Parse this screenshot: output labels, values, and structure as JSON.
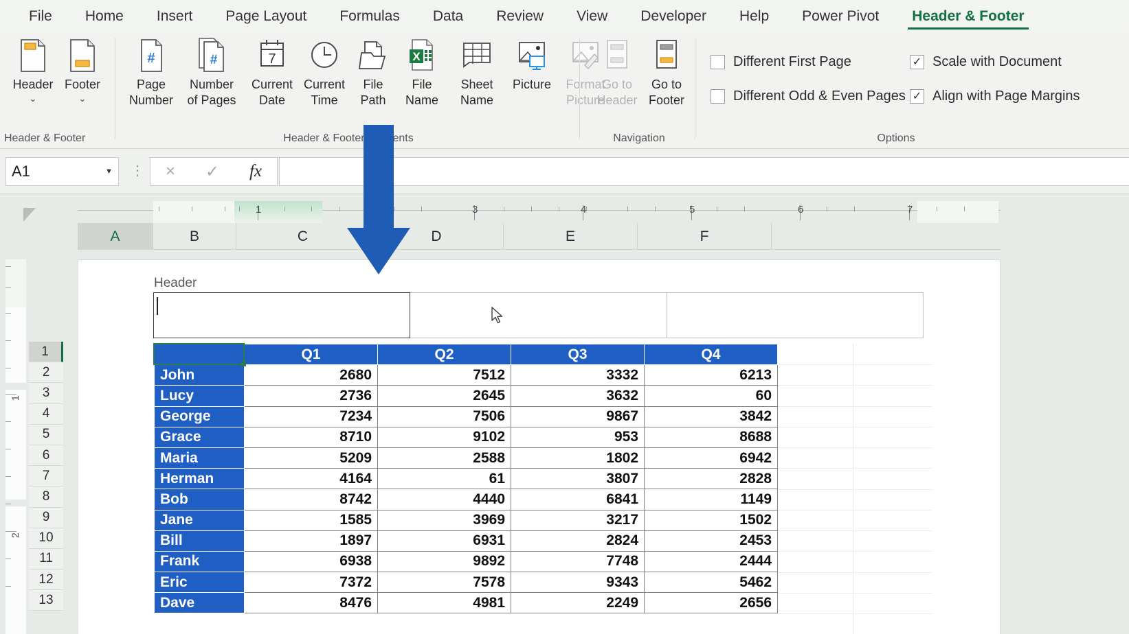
{
  "app": {
    "active_cell": "A1",
    "formula_value": ""
  },
  "ribbon_tabs": [
    {
      "label": "File",
      "active": false
    },
    {
      "label": "Home",
      "active": false
    },
    {
      "label": "Insert",
      "active": false
    },
    {
      "label": "Page Layout",
      "active": false
    },
    {
      "label": "Formulas",
      "active": false
    },
    {
      "label": "Data",
      "active": false
    },
    {
      "label": "Review",
      "active": false
    },
    {
      "label": "View",
      "active": false
    },
    {
      "label": "Developer",
      "active": false
    },
    {
      "label": "Help",
      "active": false
    },
    {
      "label": "Power Pivot",
      "active": false
    },
    {
      "label": "Header & Footer",
      "active": true
    }
  ],
  "ribbon_groups": {
    "header_footer": {
      "label": "Header & Footer",
      "buttons": [
        {
          "line1": "Header",
          "line2": "",
          "caret": "⌄",
          "icon": "header-document-icon",
          "disabled": false
        },
        {
          "line1": "Footer",
          "line2": "",
          "caret": "⌄",
          "icon": "footer-document-icon",
          "disabled": false
        }
      ]
    },
    "elements": {
      "label": "Header & Footer Elements",
      "buttons": [
        {
          "line1": "Page",
          "line2": "Number",
          "icon": "page-number-icon",
          "disabled": false
        },
        {
          "line1": "Number",
          "line2": "of Pages",
          "icon": "number-of-pages-icon",
          "disabled": false
        },
        {
          "line1": "Current",
          "line2": "Date",
          "icon": "calendar-icon",
          "disabled": false
        },
        {
          "line1": "Current",
          "line2": "Time",
          "icon": "clock-icon",
          "disabled": false
        },
        {
          "line1": "File",
          "line2": "Path",
          "icon": "folder-file-icon",
          "disabled": false
        },
        {
          "line1": "File",
          "line2": "Name",
          "icon": "excel-file-icon",
          "disabled": false
        },
        {
          "line1": "Sheet",
          "line2": "Name",
          "icon": "sheet-grid-icon",
          "disabled": false
        },
        {
          "line1": "Picture",
          "line2": "",
          "icon": "picture-icon",
          "disabled": false
        },
        {
          "line1": "Format",
          "line2": "Picture",
          "icon": "format-picture-icon",
          "disabled": true
        }
      ]
    },
    "navigation": {
      "label": "Navigation",
      "buttons": [
        {
          "line1": "Go to",
          "line2": "Header",
          "icon": "go-to-header-icon",
          "disabled": true
        },
        {
          "line1": "Go to",
          "line2": "Footer",
          "icon": "go-to-footer-icon",
          "disabled": false
        }
      ]
    },
    "options": {
      "label": "Options",
      "checkboxes": [
        {
          "label": "Different First Page",
          "checked": false
        },
        {
          "label": "Different Odd & Even Pages",
          "checked": false
        },
        {
          "label": "Scale with Document",
          "checked": true
        },
        {
          "label": "Align with Page Margins",
          "checked": true
        }
      ]
    }
  },
  "formula_bar": {
    "name_box_value": "A1",
    "cancel_icon": "×",
    "enter_icon": "✓",
    "fx_icon": "fx",
    "input_value": ""
  },
  "rulers": {
    "horizontal_numbers": [
      "1",
      "2",
      "3",
      "4",
      "5",
      "6",
      "7"
    ],
    "vertical_numbers": [
      "1",
      "2"
    ]
  },
  "grid": {
    "columns": [
      "A",
      "B",
      "C",
      "D",
      "E",
      "F"
    ],
    "selected_column": "A",
    "rows": [
      "1",
      "2",
      "3",
      "4",
      "5",
      "6",
      "7",
      "8",
      "9",
      "10",
      "11",
      "12",
      "13"
    ],
    "selected_row": "1"
  },
  "page_header": {
    "label": "Header",
    "boxes": [
      {
        "value": "",
        "active": true
      },
      {
        "value": "",
        "active": false
      },
      {
        "value": "",
        "active": false
      }
    ]
  },
  "chart_data": {
    "type": "table",
    "title": "",
    "columns": [
      "",
      "Q1",
      "Q2",
      "Q3",
      "Q4"
    ],
    "rows": [
      {
        "name": "John",
        "values": [
          2680,
          7512,
          3332,
          6213
        ]
      },
      {
        "name": "Lucy",
        "values": [
          2736,
          2645,
          3632,
          60
        ]
      },
      {
        "name": "George",
        "values": [
          7234,
          7506,
          9867,
          3842
        ]
      },
      {
        "name": "Grace",
        "values": [
          8710,
          9102,
          953,
          8688
        ]
      },
      {
        "name": "Maria",
        "values": [
          5209,
          2588,
          1802,
          6942
        ]
      },
      {
        "name": "Herman",
        "values": [
          4164,
          61,
          3807,
          2828
        ]
      },
      {
        "name": "Bob",
        "values": [
          8742,
          4440,
          6841,
          1149
        ]
      },
      {
        "name": "Jane",
        "values": [
          1585,
          3969,
          3217,
          1502
        ]
      },
      {
        "name": "Bill",
        "values": [
          1897,
          6931,
          2824,
          2453
        ]
      },
      {
        "name": "Frank",
        "values": [
          6938,
          9892,
          7748,
          2444
        ]
      },
      {
        "name": "Eric",
        "values": [
          7372,
          7578,
          9343,
          5462
        ]
      },
      {
        "name": "Dave",
        "values": [
          8476,
          4981,
          2249,
          2656
        ]
      }
    ]
  },
  "colors": {
    "table_blue": "#1F5FC4",
    "accent_green": "#127042",
    "annotation_blue": "#1F5CB5",
    "selection_green": "#2a7d4f"
  },
  "annotation": {
    "arrow": "down-arrow-annotation"
  }
}
